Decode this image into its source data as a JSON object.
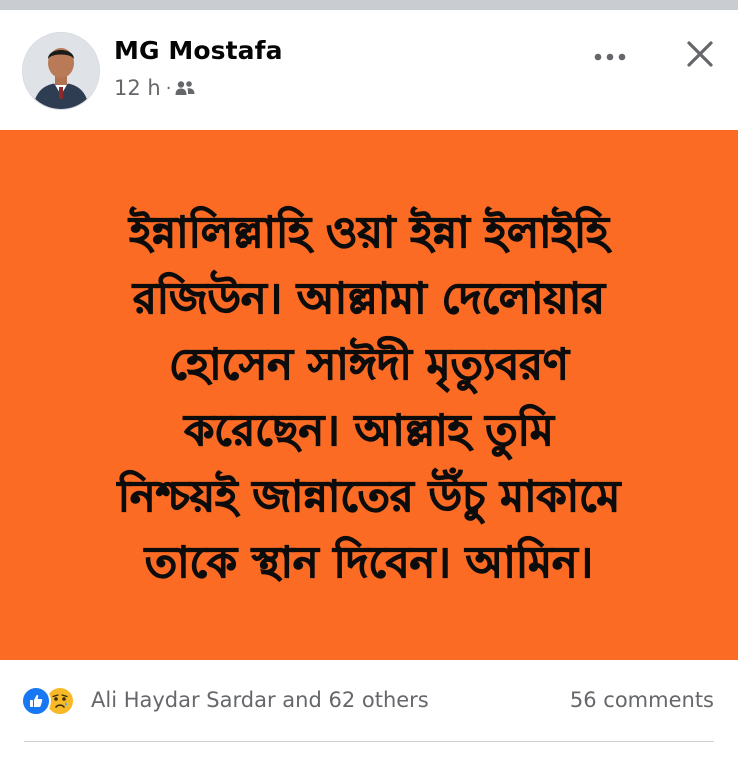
{
  "post": {
    "author": "MG Mostafa",
    "time": "12 h",
    "separator": "·",
    "audience_icon": "friends-icon",
    "more_icon": "more-horizontal-icon",
    "close_icon": "close-icon",
    "image_text": "ইন্নালিল্লাহি ওয়া ইন্না ইলাইহি\nরজিউন। আল্লামা দেলোয়ার\nহোসেন সাঈদী মৃত্যুবরণ\nকরেছেন। আল্লাহ তুমি\nনিশ্চয়ই জান্নাতের উঁচু মাকামে\nতাকে স্থান দিবেন। আমিন।"
  },
  "reactions": {
    "icons": [
      "like-reaction-icon",
      "sad-reaction-icon"
    ],
    "summary": "Ali Haydar Sardar and 62 others",
    "comments": "56 comments"
  },
  "colors": {
    "image_background": "#fb6b23",
    "text": "#0c0c0c",
    "secondary_text": "#65676b",
    "like_blue": "#1877f2",
    "sad_yellow": "#f7b928"
  }
}
